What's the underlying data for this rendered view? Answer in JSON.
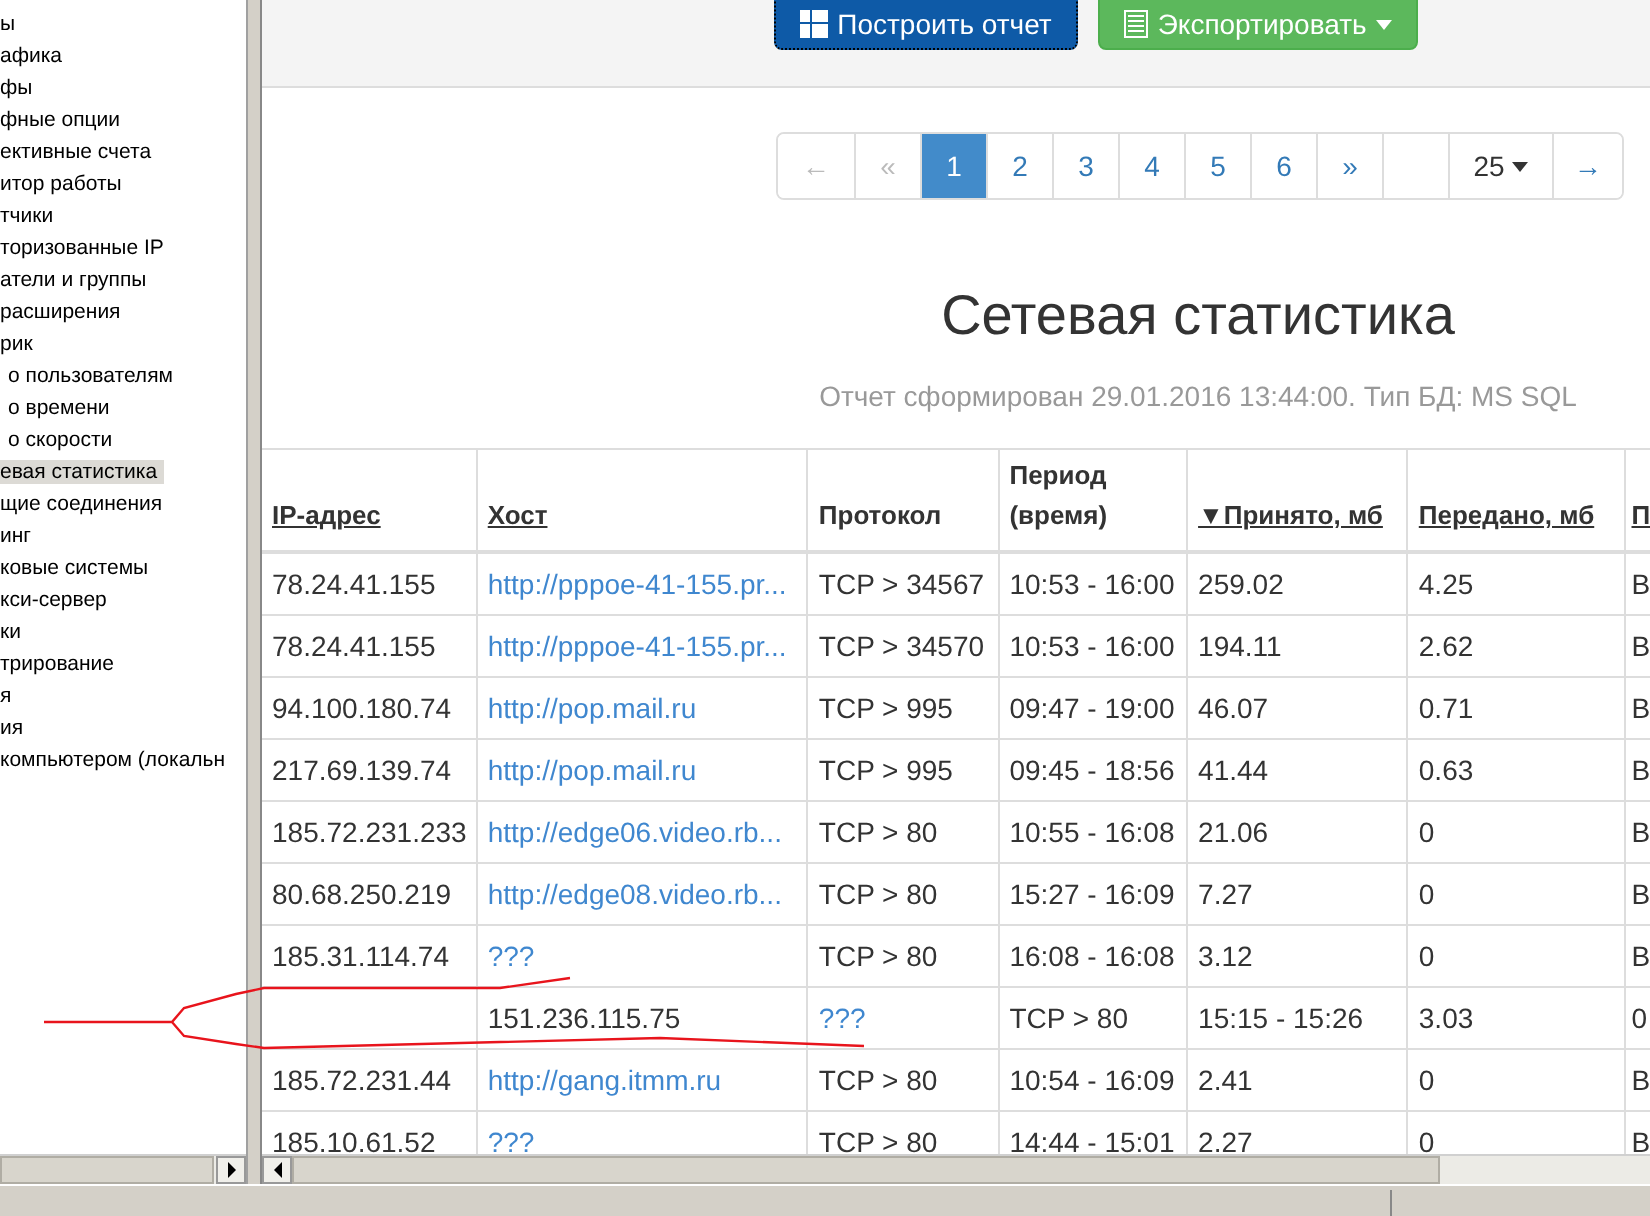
{
  "sidebar": {
    "items": [
      {
        "label": "ы",
        "selected": false
      },
      {
        "label": "афика",
        "selected": false
      },
      {
        "label": "фы",
        "selected": false
      },
      {
        "label": "фные опции",
        "selected": false
      },
      {
        "label": "ективные счета",
        "selected": false
      },
      {
        "label": "итор работы",
        "selected": false
      },
      {
        "label": "тчики",
        "selected": false
      },
      {
        "label": "торизованные IP",
        "selected": false
      },
      {
        "label": "атели и группы",
        "selected": false
      },
      {
        "label": "расширения",
        "selected": false
      },
      {
        "label": "рик",
        "selected": false,
        "children": [
          {
            "label": "о пользователям",
            "selected": false
          },
          {
            "label": "о времени",
            "selected": false
          },
          {
            "label": "о скорости",
            "selected": false
          }
        ]
      },
      {
        "label": "евая статистика",
        "selected": true
      },
      {
        "label": "щие соединения",
        "selected": false
      },
      {
        "label": "инг",
        "selected": false
      },
      {
        "label": "ковые системы",
        "selected": false
      },
      {
        "label": "кси-сервер",
        "selected": false
      },
      {
        "label": "ки",
        "selected": false
      },
      {
        "label": "трирование",
        "selected": false
      },
      {
        "label": "я",
        "selected": false
      },
      {
        "label": "ия",
        "selected": false
      },
      {
        "label": "компьютером (локальн",
        "selected": false
      }
    ]
  },
  "toolbar": {
    "buttons": [
      {
        "label": "Построить отчет",
        "kind": "primary",
        "dropdown": false
      },
      {
        "label": "Экспортировать",
        "kind": "success",
        "dropdown": true
      }
    ]
  },
  "pagination": {
    "items": [
      {
        "label": "←",
        "disabled": true,
        "selected": false
      },
      {
        "label": "«",
        "disabled": true,
        "selected": false
      },
      {
        "label": "1",
        "disabled": false,
        "selected": true
      },
      {
        "label": "2",
        "disabled": false,
        "selected": false
      },
      {
        "label": "3",
        "disabled": false,
        "selected": false
      },
      {
        "label": "4",
        "disabled": false,
        "selected": false
      },
      {
        "label": "5",
        "disabled": false,
        "selected": false
      },
      {
        "label": "6",
        "disabled": false,
        "selected": false
      },
      {
        "label": "»",
        "disabled": false,
        "selected": false
      }
    ],
    "page_size": "25",
    "next": "→"
  },
  "report": {
    "title": "Сетевая статистика",
    "subtitle": "Отчет сформирован 29.01.2016 13:44:00. Тип БД: MS SQL"
  },
  "table": {
    "columns": [
      {
        "label": "IP-адрес",
        "sortable": true
      },
      {
        "label": "Хост",
        "sortable": true
      },
      {
        "label": "Протокол",
        "sortable": false
      },
      {
        "label": "Период (время)",
        "sortable": false
      },
      {
        "label": "▼Принято, мб",
        "sortable": true
      },
      {
        "label": "Передано, мб",
        "sortable": true
      },
      {
        "label": "П",
        "sortable": true
      }
    ],
    "rows": [
      {
        "cells": [
          {
            "kind": "text",
            "text": "78.24.41.155"
          },
          {
            "kind": "link",
            "text": "http://pppoe-41-155.pr..."
          },
          {
            "kind": "text",
            "text": "TCP > 34567"
          },
          {
            "kind": "text",
            "text": "10:53 - 16:00"
          },
          {
            "kind": "text",
            "text": "259.02"
          },
          {
            "kind": "text",
            "text": "4.25"
          },
          {
            "kind": "text",
            "text": "В"
          }
        ]
      },
      {
        "cells": [
          {
            "kind": "text",
            "text": "78.24.41.155"
          },
          {
            "kind": "link",
            "text": "http://pppoe-41-155.pr..."
          },
          {
            "kind": "text",
            "text": "TCP > 34570"
          },
          {
            "kind": "text",
            "text": "10:53 - 16:00"
          },
          {
            "kind": "text",
            "text": "194.11"
          },
          {
            "kind": "text",
            "text": "2.62"
          },
          {
            "kind": "text",
            "text": "В"
          }
        ]
      },
      {
        "cells": [
          {
            "kind": "text",
            "text": "94.100.180.74"
          },
          {
            "kind": "link",
            "text": "http://pop.mail.ru"
          },
          {
            "kind": "text",
            "text": "TCP > 995"
          },
          {
            "kind": "text",
            "text": "09:47 - 19:00"
          },
          {
            "kind": "text",
            "text": "46.07"
          },
          {
            "kind": "text",
            "text": "0.71"
          },
          {
            "kind": "text",
            "text": "В"
          }
        ]
      },
      {
        "cells": [
          {
            "kind": "text",
            "text": "217.69.139.74"
          },
          {
            "kind": "link",
            "text": "http://pop.mail.ru"
          },
          {
            "kind": "text",
            "text": "TCP > 995"
          },
          {
            "kind": "text",
            "text": "09:45 - 18:56"
          },
          {
            "kind": "text",
            "text": "41.44"
          },
          {
            "kind": "text",
            "text": "0.63"
          },
          {
            "kind": "text",
            "text": "В"
          }
        ]
      },
      {
        "cells": [
          {
            "kind": "text",
            "text": "185.72.231.233"
          },
          {
            "kind": "link",
            "text": "http://edge06.video.rb..."
          },
          {
            "kind": "text",
            "text": "TCP > 80"
          },
          {
            "kind": "text",
            "text": "10:55 - 16:08"
          },
          {
            "kind": "text",
            "text": "21.06"
          },
          {
            "kind": "text",
            "text": "0"
          },
          {
            "kind": "text",
            "text": "В"
          }
        ]
      },
      {
        "cells": [
          {
            "kind": "text",
            "text": "80.68.250.219"
          },
          {
            "kind": "link",
            "text": "http://edge08.video.rb..."
          },
          {
            "kind": "text",
            "text": "TCP > 80"
          },
          {
            "kind": "text",
            "text": "15:27 - 16:09"
          },
          {
            "kind": "text",
            "text": "7.27"
          },
          {
            "kind": "text",
            "text": "0"
          },
          {
            "kind": "text",
            "text": "В"
          }
        ]
      },
      {
        "cells": [
          {
            "kind": "text",
            "text": "185.31.114.74"
          },
          {
            "kind": "link",
            "text": "???"
          },
          {
            "kind": "text",
            "text": "TCP > 80"
          },
          {
            "kind": "text",
            "text": "16:08 - 16:08"
          },
          {
            "kind": "text",
            "text": "3.12"
          },
          {
            "kind": "text",
            "text": "0"
          },
          {
            "kind": "text",
            "text": "В"
          }
        ]
      },
      {
        "cells": [
          {
            "kind": "empty"
          },
          {
            "kind": "text",
            "text": "151.236.115.75"
          },
          {
            "kind": "link",
            "text": "???"
          },
          {
            "kind": "text",
            "text": "TCP > 80"
          },
          {
            "kind": "text",
            "text": "15:15 - 15:26"
          },
          {
            "kind": "text",
            "text": "3.03"
          },
          {
            "kind": "text",
            "text": "0"
          }
        ]
      },
      {
        "cells": [
          {
            "kind": "text",
            "text": "185.72.231.44"
          },
          {
            "kind": "link",
            "text": "http://gang.itmm.ru"
          },
          {
            "kind": "text",
            "text": "TCP > 80"
          },
          {
            "kind": "text",
            "text": "10:54 - 16:09"
          },
          {
            "kind": "text",
            "text": "2.41"
          },
          {
            "kind": "text",
            "text": "0"
          },
          {
            "kind": "text",
            "text": "В"
          }
        ]
      },
      {
        "cells": [
          {
            "kind": "text",
            "text": "185.10.61.52"
          },
          {
            "kind": "link",
            "text": "???"
          },
          {
            "kind": "text",
            "text": "TCP > 80"
          },
          {
            "kind": "text",
            "text": "14:44 - 15:01"
          },
          {
            "kind": "text",
            "text": "2.27"
          },
          {
            "kind": "text",
            "text": "0"
          },
          {
            "kind": "text",
            "text": "В"
          }
        ]
      }
    ]
  }
}
